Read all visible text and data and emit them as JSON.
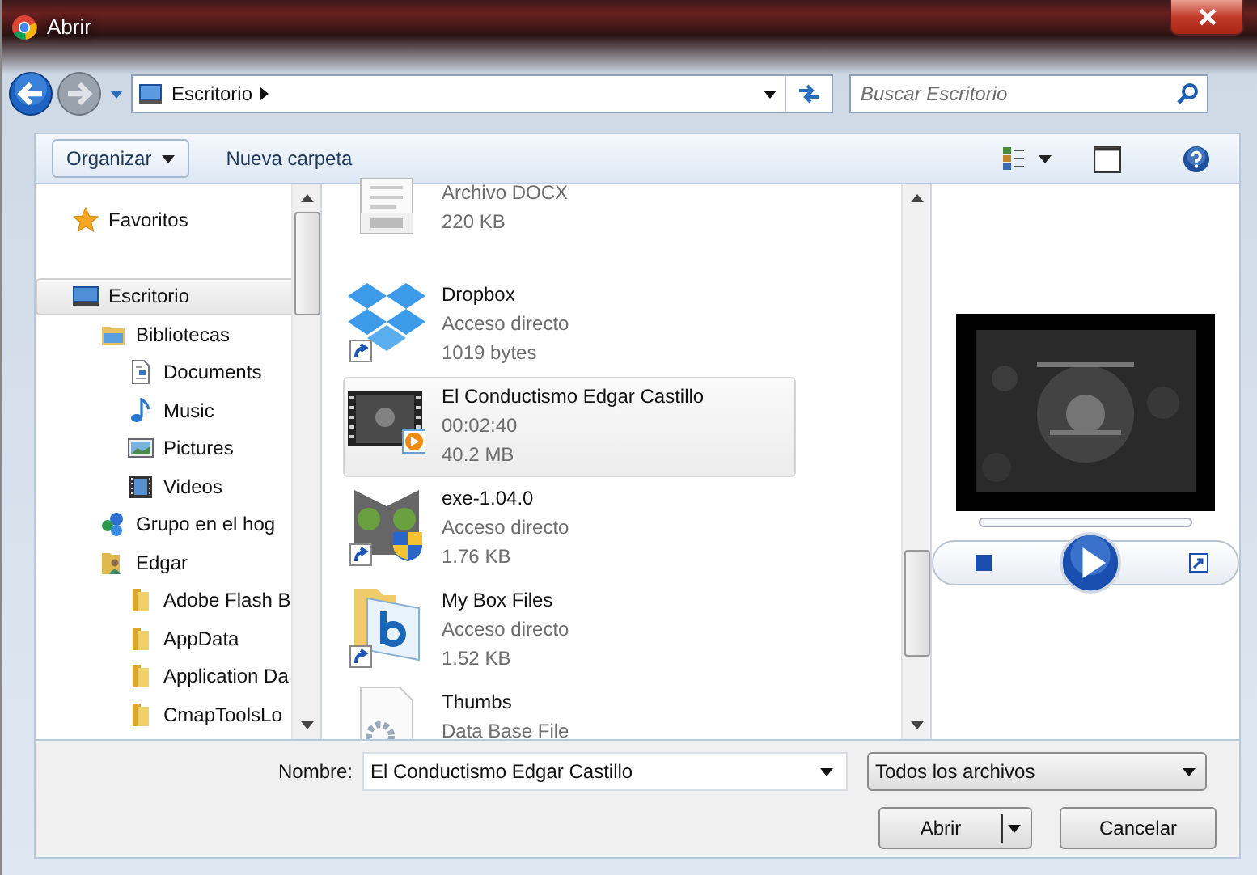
{
  "window": {
    "title": "Abrir"
  },
  "address": {
    "location": "Escritorio",
    "search_placeholder": "Buscar Escritorio"
  },
  "toolbar": {
    "organize": "Organizar",
    "new_folder": "Nueva carpeta"
  },
  "sidebar": {
    "items": [
      {
        "label": "Favoritos",
        "kind": "star",
        "selected": false
      },
      {
        "label": "Escritorio",
        "kind": "desktop",
        "selected": true,
        "children": [
          {
            "label": "Bibliotecas",
            "kind": "library",
            "selected": false,
            "children": [
              {
                "label": "Documents",
                "kind": "document",
                "selected": false
              },
              {
                "label": "Music",
                "kind": "music",
                "selected": false
              },
              {
                "label": "Pictures",
                "kind": "pictures",
                "selected": false
              },
              {
                "label": "Videos",
                "kind": "video",
                "selected": false
              }
            ]
          },
          {
            "label": "Grupo en el hog",
            "kind": "homegroup",
            "selected": false
          },
          {
            "label": "Edgar",
            "kind": "user",
            "selected": false,
            "children": [
              {
                "label": "Adobe Flash B",
                "kind": "folder",
                "selected": false
              },
              {
                "label": "AppData",
                "kind": "folder",
                "selected": false
              },
              {
                "label": "Application Da",
                "kind": "folder",
                "selected": false
              },
              {
                "label": "CmapToolsLo",
                "kind": "folder",
                "selected": false
              }
            ]
          }
        ]
      }
    ]
  },
  "files": [
    {
      "kind": "docx",
      "details": [
        "Archivo DOCX",
        "220 KB"
      ],
      "shortcut": false,
      "selected": false
    },
    {
      "kind": "dropbox",
      "name": "Dropbox",
      "details": [
        "Acceso directo",
        "1019 bytes"
      ],
      "shortcut": true,
      "selected": false
    },
    {
      "kind": "video",
      "name": "El Conductismo Edgar Castillo",
      "details": [
        "00:02:40",
        "40.2 MB"
      ],
      "shortcut": false,
      "selected": true
    },
    {
      "kind": "exe",
      "name": "exe-1.04.0",
      "details": [
        "Acceso directo",
        "1.76 KB"
      ],
      "shortcut": true,
      "selected": false
    },
    {
      "kind": "box",
      "name": "My Box Files",
      "details": [
        "Acceso directo",
        "1.52 KB"
      ],
      "shortcut": true,
      "selected": false
    },
    {
      "kind": "database",
      "name": "Thumbs",
      "details": [
        "Data Base File"
      ],
      "shortcut": false,
      "selected": false
    }
  ],
  "footer": {
    "name_label": "Nombre:",
    "file_name": "El Conductismo Edgar Castillo",
    "filter": "Todos los archivos",
    "open": "Abrir",
    "cancel": "Cancelar"
  }
}
